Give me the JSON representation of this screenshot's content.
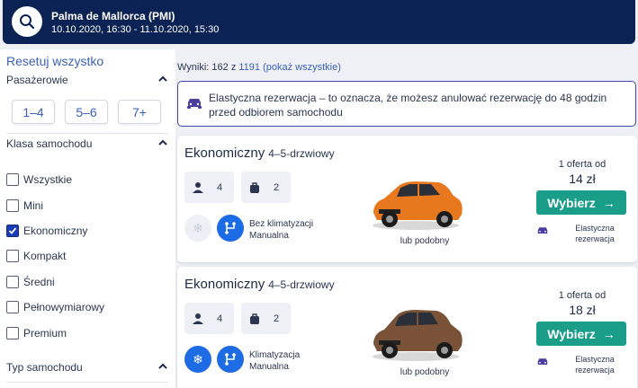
{
  "header": {
    "location": "Palma de Mallorca (PMI)",
    "dates": "10.10.2020, 16:30 - 11.10.2020, 15:30"
  },
  "sidebar": {
    "reset": "Resetuj wszystko",
    "passengers": {
      "title": "Pasażerowie",
      "options": [
        "1–4",
        "5–6",
        "7+"
      ]
    },
    "car_class": {
      "title": "Klasa samochodu",
      "items": [
        {
          "label": "Wszystkie",
          "checked": false
        },
        {
          "label": "Mini",
          "checked": false
        },
        {
          "label": "Ekonomiczny",
          "checked": true
        },
        {
          "label": "Kompakt",
          "checked": false
        },
        {
          "label": "Średni",
          "checked": false
        },
        {
          "label": "Pełnowymiarowy",
          "checked": false
        },
        {
          "label": "Premium",
          "checked": false
        }
      ]
    },
    "car_type": {
      "title": "Typ samochodu"
    }
  },
  "results": {
    "prefix": "Wyniki: 162 z ",
    "total": "1191",
    "show_all": "(pokaż wszystkie)"
  },
  "notice": {
    "text": "Elastyczna rezerwacja – to oznacza, że możesz anulować rezerwację do 48 godzin przed odbiorem samochodu"
  },
  "cards": [
    {
      "name": "Ekonomiczny",
      "doors": "4–5-drzwiowy",
      "seats": "4",
      "bags": "2",
      "ac": "Bez klimatyzacji",
      "transmission": "Manualna",
      "similar": "lub podobny",
      "offer": "1 oferta od",
      "price": "14 zł",
      "select": "Wybierz",
      "flex": "Elastyczna rezerwacja",
      "car_color": "#e8781e"
    },
    {
      "name": "Ekonomiczny",
      "doors": "4–5-drzwiowy",
      "seats": "4",
      "bags": "2",
      "ac": "Klimatyzacja",
      "transmission": "Manualna",
      "similar": "lub podobny",
      "offer": "1 oferta od",
      "price": "18 zł",
      "select": "Wybierz",
      "flex": "Elastyczna rezerwacja",
      "car_color": "#7a5238"
    }
  ],
  "colors": {
    "header": "#0b2354",
    "accent": "#3b62b8",
    "select_button": "#1a9e8a",
    "feature_blue": "#1e6be6"
  }
}
